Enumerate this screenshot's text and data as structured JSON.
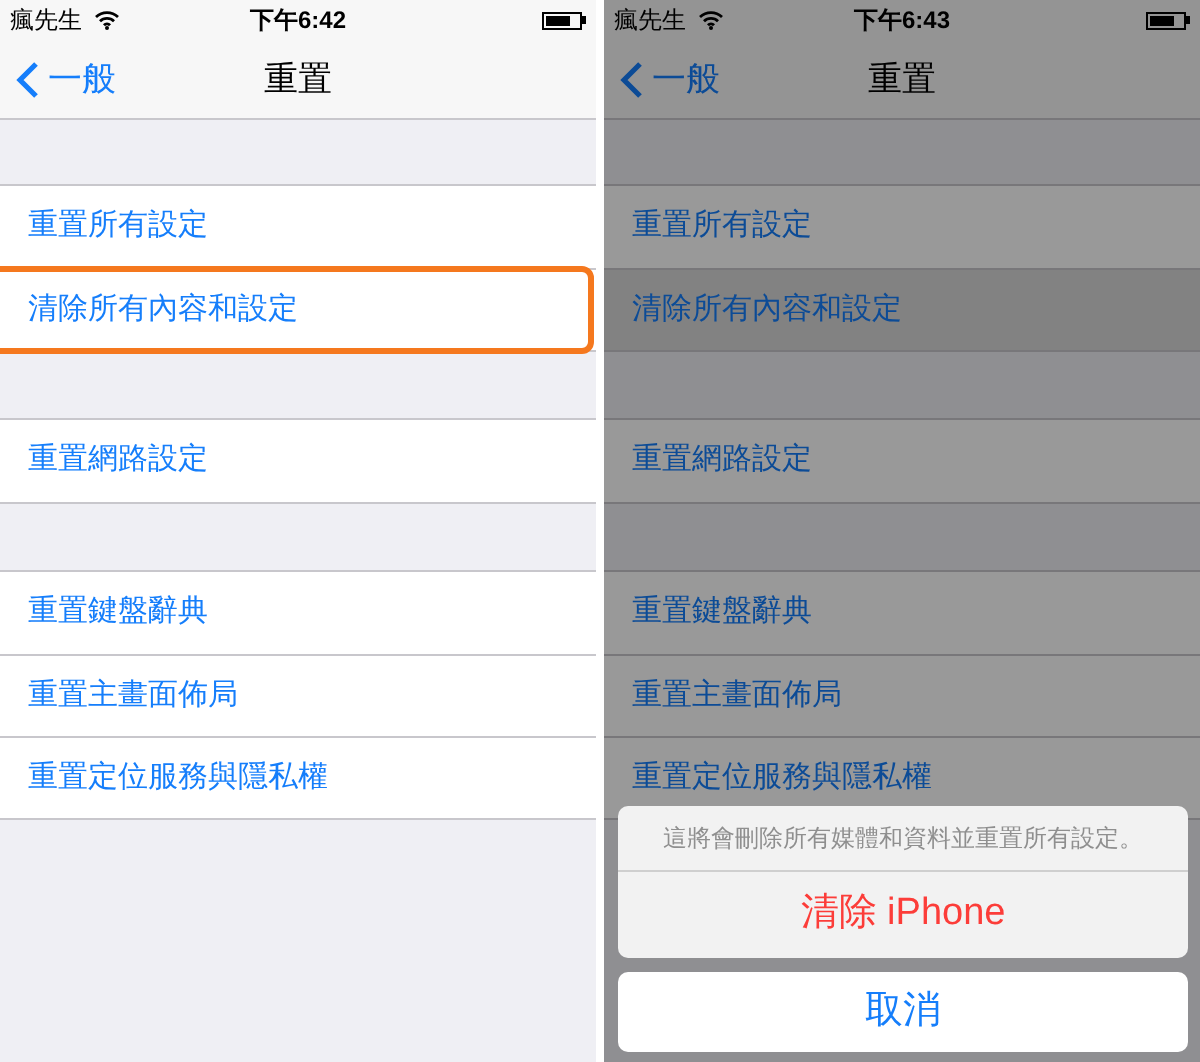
{
  "screens": [
    {
      "status_bar": {
        "carrier": "瘋先生",
        "time": "下午6:42"
      },
      "nav": {
        "back": "一般",
        "title": "重置"
      },
      "dimmed": false,
      "groups": [
        [
          {
            "label": "重置所有設定",
            "selected": false,
            "highlighted": false
          },
          {
            "label": "清除所有內容和設定",
            "selected": false,
            "highlighted": true
          }
        ],
        [
          {
            "label": "重置網路設定",
            "selected": false,
            "highlighted": false
          }
        ],
        [
          {
            "label": "重置鍵盤辭典",
            "selected": false,
            "highlighted": false
          },
          {
            "label": "重置主畫面佈局",
            "selected": false,
            "highlighted": false
          },
          {
            "label": "重置定位服務與隱私權",
            "selected": false,
            "highlighted": false
          }
        ]
      ]
    },
    {
      "status_bar": {
        "carrier": "瘋先生",
        "time": "下午6:43"
      },
      "nav": {
        "back": "一般",
        "title": "重置"
      },
      "dimmed": true,
      "groups": [
        [
          {
            "label": "重置所有設定",
            "selected": false,
            "highlighted": false
          },
          {
            "label": "清除所有內容和設定",
            "selected": true,
            "highlighted": false
          }
        ],
        [
          {
            "label": "重置網路設定",
            "selected": false,
            "highlighted": false
          }
        ],
        [
          {
            "label": "重置鍵盤辭典",
            "selected": false,
            "highlighted": false
          },
          {
            "label": "重置主畫面佈局",
            "selected": false,
            "highlighted": false
          },
          {
            "label": "重置定位服務與隱私權",
            "selected": false,
            "highlighted": false
          }
        ]
      ],
      "action_sheet": {
        "message": "這將會刪除所有媒體和資料並重置所有設定。",
        "destructive": "清除 iPhone",
        "cancel": "取消"
      }
    }
  ]
}
